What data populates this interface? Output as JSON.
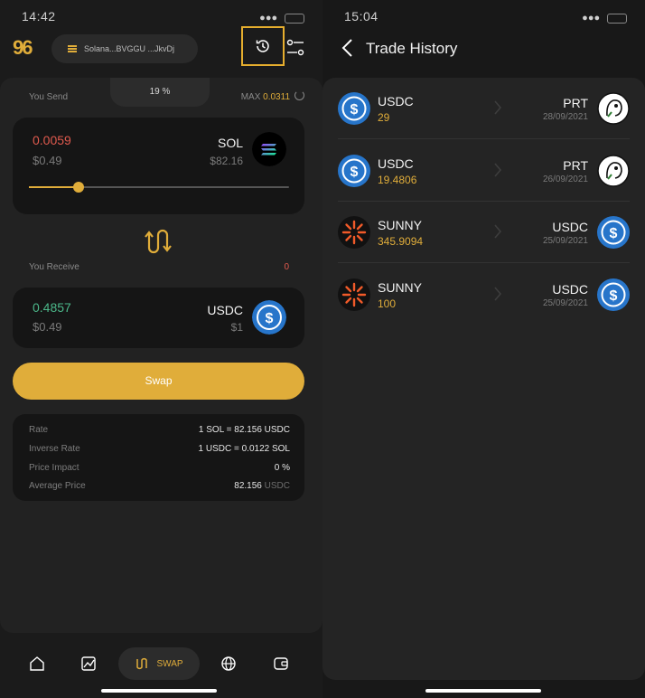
{
  "left": {
    "status": {
      "time": "14:42"
    },
    "header": {
      "logo": "96",
      "wallet": "Solana...BVGGU ...JkvDj"
    },
    "send": {
      "label": "You Send",
      "percent": "19 %",
      "max_label": "MAX",
      "max_value": "0.0311"
    },
    "from": {
      "amount": "0.0059",
      "usd": "$0.49",
      "symbol": "SOL",
      "price": "$82.16",
      "slider_fraction": 0.19
    },
    "receive": {
      "label": "You Receive",
      "value": "0"
    },
    "to": {
      "amount": "0.4857",
      "usd": "$0.49",
      "symbol": "USDC",
      "price": "$1"
    },
    "swap_label": "Swap",
    "info": [
      {
        "key": "Rate",
        "value": "1 SOL = 82.156 USDC",
        "unit": ""
      },
      {
        "key": "Inverse Rate",
        "value": "1 USDC = 0.0122 SOL",
        "unit": ""
      },
      {
        "key": "Price Impact",
        "value": "0 %",
        "unit": ""
      },
      {
        "key": "Average Price",
        "value": "82.156",
        "unit": "USDC"
      }
    ],
    "tabbar": {
      "active_label": "SWAP"
    }
  },
  "right": {
    "status": {
      "time": "15:04"
    },
    "title": "Trade History",
    "trades": [
      {
        "from_symbol": "USDC",
        "from_amount": "29",
        "to_symbol": "PRT",
        "date": "28/09/2021",
        "from_icon": "usdc-icon",
        "to_icon": "prt-icon"
      },
      {
        "from_symbol": "USDC",
        "from_amount": "19.4806",
        "to_symbol": "PRT",
        "date": "26/09/2021",
        "from_icon": "usdc-icon",
        "to_icon": "prt-icon"
      },
      {
        "from_symbol": "SUNNY",
        "from_amount": "345.9094",
        "to_symbol": "USDC",
        "date": "25/09/2021",
        "from_icon": "sunny-icon",
        "to_icon": "usdc-icon"
      },
      {
        "from_symbol": "SUNNY",
        "from_amount": "100",
        "to_symbol": "USDC",
        "date": "25/09/2021",
        "from_icon": "sunny-icon",
        "to_icon": "usdc-icon"
      }
    ]
  },
  "colors": {
    "accent": "#e0ad3a",
    "negative": "#e05a4e",
    "positive": "#4cb88a",
    "usdc": "#2775ca"
  }
}
